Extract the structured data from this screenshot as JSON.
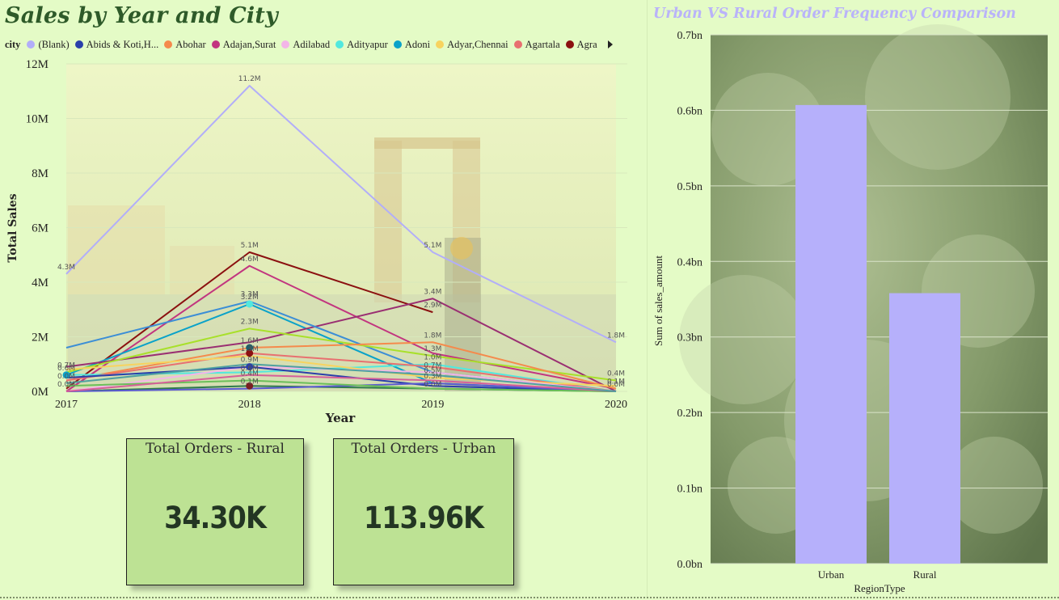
{
  "left_panel": {
    "title": "Sales by Year and City",
    "legend_title": "city",
    "legend_items": [
      {
        "label": "(Blank)",
        "color": "#b2aef9"
      },
      {
        "label": "Abids & Koti,H...",
        "color": "#2a3faa"
      },
      {
        "label": "Abohar",
        "color": "#f58a4c"
      },
      {
        "label": "Adajan,Surat",
        "color": "#c2357f"
      },
      {
        "label": "Adilabad",
        "color": "#f3b5e8"
      },
      {
        "label": "Adityapur",
        "color": "#52e8de"
      },
      {
        "label": "Adoni",
        "color": "#0aa2c9"
      },
      {
        "label": "Adyar,Chennai",
        "color": "#f7d35f"
      },
      {
        "label": "Agartala",
        "color": "#e87070"
      },
      {
        "label": "Agra",
        "color": "#8b1010"
      }
    ]
  },
  "kpis": {
    "rural": {
      "label": "Total Orders - Rural",
      "value": "34.30K"
    },
    "urban": {
      "label": "Total Orders - Urban",
      "value": "113.96K"
    }
  },
  "right_panel": {
    "title": "Urban VS Rural Order Frequency Comparison"
  },
  "chart_data": [
    {
      "type": "line",
      "title": "Sales by Year and City",
      "xlabel": "Year",
      "ylabel": "Total Sales",
      "x": [
        "2017",
        "2018",
        "2019",
        "2020"
      ],
      "y_ticks": [
        "0M",
        "2M",
        "4M",
        "6M",
        "8M",
        "10M",
        "12M"
      ],
      "ylim": [
        0,
        12
      ],
      "units": "M",
      "series": [
        {
          "name": "(Blank)",
          "color": "#b2aef9",
          "values": [
            4.3,
            11.2,
            5.1,
            1.8
          ]
        },
        {
          "name": "Agra",
          "color": "#8b1010",
          "values": [
            0.1,
            5.1,
            2.9,
            null
          ]
        },
        {
          "name": "Adajan,Surat",
          "color": "#c2357f",
          "values": [
            0.0,
            4.6,
            1.4,
            0.1
          ]
        },
        {
          "name": "Adoni",
          "color": "#0aa2c9",
          "values": [
            0.6,
            3.2,
            0.3,
            0.0
          ]
        },
        {
          "color": "#9a2f72",
          "values": [
            0.9,
            1.8,
            3.4,
            0.0
          ]
        },
        {
          "color": "#3c8ed6",
          "values": [
            1.6,
            3.3,
            0.7,
            0.0
          ]
        },
        {
          "color": "#a8e02a",
          "values": [
            0.7,
            2.3,
            1.3,
            0.4
          ]
        },
        {
          "name": "Abohar",
          "color": "#f58a4c",
          "values": [
            0.4,
            1.6,
            1.8,
            0.1
          ]
        },
        {
          "name": "Adityapur",
          "color": "#52e8de",
          "values": [
            0.6,
            0.7,
            1.0,
            0.0
          ]
        },
        {
          "name": "Agartala",
          "color": "#e87070",
          "values": [
            0.4,
            1.4,
            0.9,
            0.0
          ]
        },
        {
          "name": "Adyar,Chennai",
          "color": "#f7d35f",
          "values": [
            0.8,
            1.3,
            0.5,
            0.2
          ]
        },
        {
          "name": "Adilabad",
          "color": "#f3b5e8",
          "values": [
            0.0,
            0.9,
            0.7,
            0.0
          ]
        },
        {
          "name": "Abids & Koti,H...",
          "color": "#2a3faa",
          "values": [
            0.5,
            0.9,
            0.2,
            0.0
          ]
        },
        {
          "color": "#2e7a4a",
          "values": [
            0.0,
            0.2,
            0.1,
            0.0
          ]
        },
        {
          "color": "#5a5ad0",
          "values": [
            0.0,
            0.1,
            0.3,
            0.0
          ]
        },
        {
          "color": "#6bbf59",
          "values": [
            0.2,
            0.4,
            0.1,
            0.0
          ]
        },
        {
          "color": "#d65f9a",
          "values": [
            0.0,
            0.6,
            0.4,
            0.0
          ]
        },
        {
          "color": "#4fa0a0",
          "values": [
            0.3,
            1.0,
            0.6,
            0.0
          ]
        }
      ],
      "labels": [
        {
          "x": "2017",
          "y": 4.3,
          "text": "4.3M"
        },
        {
          "x": "2018",
          "y": 11.2,
          "text": "11.2M"
        },
        {
          "x": "2019",
          "y": 5.1,
          "text": "5.1M"
        },
        {
          "x": "2020",
          "y": 1.8,
          "text": "1.8M"
        },
        {
          "x": "2018",
          "y": 5.1,
          "text": "5.1M"
        },
        {
          "x": "2018",
          "y": 4.6,
          "text": "4.6M"
        },
        {
          "x": "2018",
          "y": 3.2,
          "text": "3.2M"
        },
        {
          "x": "2018",
          "y": 3.3,
          "text": "3.3M"
        },
        {
          "x": "2018",
          "y": 2.3,
          "text": "2.3M"
        },
        {
          "x": "2018",
          "y": 1.6,
          "text": "1.6M"
        },
        {
          "x": "2018",
          "y": 1.3,
          "text": "1.3M"
        },
        {
          "x": "2018",
          "y": 0.9,
          "text": "0.9M"
        },
        {
          "x": "2018",
          "y": 0.6,
          "text": "0.6M"
        },
        {
          "x": "2018",
          "y": 0.4,
          "text": "0.4M"
        },
        {
          "x": "2018",
          "y": 0.1,
          "text": "0.1M"
        },
        {
          "x": "2019",
          "y": 3.4,
          "text": "3.4M"
        },
        {
          "x": "2019",
          "y": 2.9,
          "text": "2.9M"
        },
        {
          "x": "2019",
          "y": 1.8,
          "text": "1.8M"
        },
        {
          "x": "2019",
          "y": 1.3,
          "text": "1.3M"
        },
        {
          "x": "2019",
          "y": 1.0,
          "text": "1.0M"
        },
        {
          "x": "2019",
          "y": 0.7,
          "text": "0.7M"
        },
        {
          "x": "2019",
          "y": 0.5,
          "text": "0.5M"
        },
        {
          "x": "2019",
          "y": 0.3,
          "text": "0.3M"
        },
        {
          "x": "2019",
          "y": 0.0,
          "text": "0.0M"
        },
        {
          "x": "2017",
          "y": 0.7,
          "text": "0.7M"
        },
        {
          "x": "2017",
          "y": 0.6,
          "text": "0.6M"
        },
        {
          "x": "2017",
          "y": 0.3,
          "text": "0.0M"
        },
        {
          "x": "2017",
          "y": 0.0,
          "text": "0.0M"
        },
        {
          "x": "2020",
          "y": 0.4,
          "text": "0.4M"
        },
        {
          "x": "2020",
          "y": 0.1,
          "text": "0.1M"
        },
        {
          "x": "2020",
          "y": 0.0,
          "text": "0.0M"
        }
      ]
    },
    {
      "type": "bar",
      "title": "Urban VS Rural Order Frequency Comparison",
      "xlabel": "RegionType",
      "ylabel": "Sum of sales_amount",
      "categories": [
        "Urban",
        "Rural"
      ],
      "values": [
        0.607,
        0.358
      ],
      "units": "bn",
      "ylim": [
        0,
        0.7
      ],
      "y_ticks": [
        "0.0bn",
        "0.1bn",
        "0.2bn",
        "0.3bn",
        "0.4bn",
        "0.5bn",
        "0.6bn",
        "0.7bn"
      ],
      "bar_color": "#b6b0fb",
      "grid": true
    }
  ]
}
